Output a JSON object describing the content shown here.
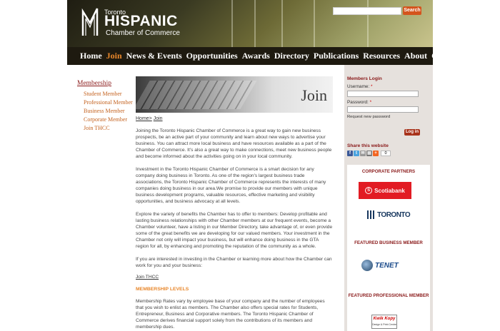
{
  "header": {
    "logo_toronto": "Toronto",
    "logo_hispanic": "HISPANIC",
    "logo_chamber": "Chamber of Commerce",
    "search_button": "Search"
  },
  "nav": {
    "items": [
      "Home",
      "Join",
      "News & Events",
      "Opportunities",
      "Awards",
      "Directory",
      "Publications",
      "Resources",
      "About",
      "Contact"
    ],
    "active": "Join"
  },
  "sidebar": {
    "title": "Membership",
    "items": [
      "Student Member",
      "Professional Member",
      "Business Member",
      "Corporate Member",
      "Join THCC"
    ]
  },
  "main": {
    "hero_label": "Join",
    "breadcrumb_home": "Home>",
    "breadcrumb_current": "Join",
    "paragraphs": [
      "Joining the Toronto Hispanic Chamber of Commerce is a great way to gain new business prospects, be an active part of your community and learn about new ways to advertise your business. You can attract more local business and have resources available as a part of the Chamber of Commerce. It's also a great way to make connections, meet new business people and become informed about the activities going on in your local community.",
      "Investment in the Toronto Hispanic Chamber of Commerce is a smart decision for any company doing business in Toronto. As one of the region's largest business trade associations, the Toronto Hispanic Chamber of Commerce represents the interests of many companies doing business in our area.We promise to provide our members with unique business development programs, valuable resources, effective marketing and visibility opportunities, and business advocacy at all levels.",
      "Explore the variety of benefits the Chamber has to offer to members: Develop profitable and lasting business relationships with other Chamber members at our frequent events, become a Chamber volunteer, have a listing in our Member Directory, take advantage of, or even provide some of the great benefits we are developing for our valued members. Your investment in the Chamber not only will impact your business, but will enhance doing business in the GTA region for all, by enhancing and promoting the reputation of the community as a whole.",
      "If you are interested in investing in the Chamber or learning more about how the Chamber can work for you and your business:"
    ],
    "join_link": "Join THCC",
    "membership_levels_heading": "MEMBERSHIP LEVELS",
    "membership_levels_text": "Membership Rates vary by employee base of your company and the number of employees that you wish to enlist as members. The Chamber also offers special rates for Students, Entrepreneur, Business and Corporative members. The Toronto Hispanic Chamber of Commerce derives financial support solely from the contributions of its members and membership dues."
  },
  "login": {
    "title": "Members Login",
    "username_label": "Username:",
    "password_label": "Password:",
    "required_mark": "*",
    "request_password": "Request new password",
    "login_button": "Log in"
  },
  "share": {
    "title": "Share this website",
    "count": "0"
  },
  "partners": {
    "corporate_heading": "CORPORATE PARTNERS",
    "scotiabank": "Scotiabank",
    "toronto": "TORONTO",
    "featured_business_heading": "FEATURED BUSINESS MEMBER",
    "tenet": "TENET",
    "featured_professional_heading": "FEATURED PROFESSIONAL MEMBER",
    "kwik_line1": "Kwik Kopy",
    "kwik_line2": "Design & Print Centre"
  },
  "colors": {
    "accent_orange": "#e8872b",
    "dark_red": "#8a1a1a",
    "nav_bg": "#1e1a10",
    "sidebar_bg": "#e6e1dd"
  }
}
